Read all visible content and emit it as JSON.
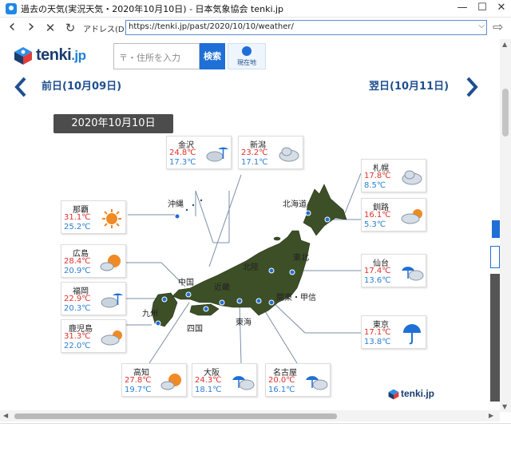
{
  "window": {
    "title": "過去の天気(実況天気・2020年10月10日) - 日本気象協会 tenki.jp",
    "minimize_glyph": "—",
    "maximize_glyph": "☐",
    "close_glyph": "✕"
  },
  "address_bar": {
    "back_glyph": "‹",
    "forward_glyph": "›",
    "stop_glyph": "✕",
    "refresh_glyph": "↻",
    "label": "アドレス(D)",
    "url": "https://tenki.jp/past/2020/10/10/weather/",
    "dropdown_glyph": "⌵",
    "go_glyph": "⇨"
  },
  "site": {
    "logo_main": "tenki",
    "logo_suffix": ".jp",
    "search_placeholder": "〒・住所を入力",
    "search_button": "検索",
    "location_button": "現在地"
  },
  "navigation": {
    "prev_day": "前日(10月09日)",
    "next_day": "翌日(10月11日)"
  },
  "map": {
    "date": "2020年10月10日",
    "regions": [
      "沖縄",
      "北海道",
      "東北",
      "北陸",
      "中国",
      "近畿",
      "九州",
      "四国",
      "東海",
      "関東・甲信"
    ],
    "cities": [
      {
        "name": "金沢",
        "high": "24.8℃",
        "low": "17.3℃",
        "weather": "cloudy-rain"
      },
      {
        "name": "新潟",
        "high": "23.2℃",
        "low": "17.1℃",
        "weather": "cloudy"
      },
      {
        "name": "札幌",
        "high": "17.8℃",
        "low": "8.5℃",
        "weather": "cloudy"
      },
      {
        "name": "釧路",
        "high": "16.1℃",
        "low": "5.3℃",
        "weather": "cloudy-sunny"
      },
      {
        "name": "那覇",
        "high": "31.1℃",
        "low": "25.2℃",
        "weather": "sunny"
      },
      {
        "name": "広島",
        "high": "28.4℃",
        "low": "20.9℃",
        "weather": "sunny-cloudy"
      },
      {
        "name": "福岡",
        "high": "22.9℃",
        "low": "20.3℃",
        "weather": "cloudy-rain"
      },
      {
        "name": "仙台",
        "high": "17.4℃",
        "low": "13.6℃",
        "weather": "rain-cloudy"
      },
      {
        "name": "鹿児島",
        "high": "31.3℃",
        "low": "22.0℃",
        "weather": "cloudy-sunny"
      },
      {
        "name": "東京",
        "high": "17.1℃",
        "low": "13.8℃",
        "weather": "rain"
      },
      {
        "name": "高知",
        "high": "27.8℃",
        "low": "19.7℃",
        "weather": "sunny-cloudy"
      },
      {
        "name": "大阪",
        "high": "24.3℃",
        "low": "18.1℃",
        "weather": "rain-cloudy"
      },
      {
        "name": "名古屋",
        "high": "20.0℃",
        "low": "16.1℃",
        "weather": "rain-cloudy"
      }
    ],
    "brand_main": "tenki",
    "brand_suffix": ".jp"
  },
  "colors": {
    "accent": "#1f6fd6",
    "high_temp": "#e0302a",
    "low_temp": "#2a7fd6",
    "date_badge": "#4c4c4c",
    "land": "#3d4f27"
  }
}
